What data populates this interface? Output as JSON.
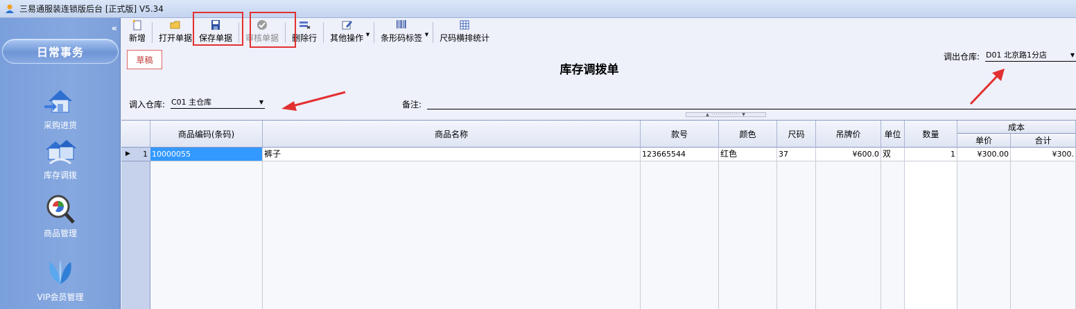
{
  "window": {
    "title": "三易通服装连锁版后台 [正式版] V5.34"
  },
  "sidebar": {
    "section_label": "日常事务",
    "items": [
      {
        "label": "采购进货",
        "icon": "house-arrow-icon"
      },
      {
        "label": "库存调拨",
        "icon": "warehouse-transfer-icon"
      },
      {
        "label": "商品管理",
        "icon": "magnifier-icon"
      },
      {
        "label": "VIP会员管理",
        "icon": "butterfly-icon"
      }
    ]
  },
  "toolbar": {
    "new_label": "新增",
    "open_label": "打开单据",
    "save_label": "保存单据",
    "audit_label": "审核单据",
    "delete_row_label": "删除行",
    "other_ops_label": "其他操作",
    "barcode_label": "条形码标签",
    "size_stats_label": "尺码横排统计"
  },
  "form": {
    "status_badge": "草稿",
    "title": "库存调拨单",
    "out_warehouse_label": "调出仓库:",
    "out_warehouse_value": "D01 北京路1分店",
    "in_warehouse_label": "调入仓库:",
    "in_warehouse_value": "C01 主仓库",
    "note_label": "备注:",
    "note_value": ""
  },
  "grid": {
    "headers": {
      "code": "商品编码(条码)",
      "name": "商品名称",
      "style_no": "款号",
      "color": "颜色",
      "size": "尺码",
      "tag_price": "吊牌价",
      "unit": "单位",
      "qty": "数量",
      "cost": "成本",
      "cost_unit": "单价",
      "cost_total": "合计"
    },
    "rows": [
      {
        "index": "1",
        "code": "10000055",
        "name": "裤子",
        "style_no": "123665544",
        "color": "红色",
        "size": "37",
        "tag_price": "¥600.0",
        "unit": "双",
        "qty": "1",
        "cost_unit": "¥300.00",
        "cost_total": "¥300."
      }
    ]
  },
  "colors": {
    "sidebar_bg": "#7c9fd9",
    "highlight_box": "#e23030",
    "selected_cell": "#3399ff"
  }
}
